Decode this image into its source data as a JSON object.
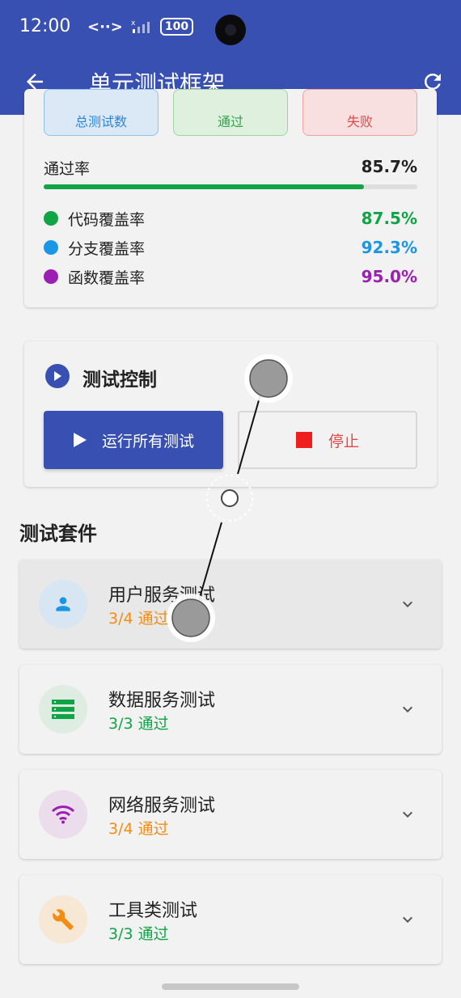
{
  "status_bar": {
    "time": "12:00",
    "net_icon": "<··>",
    "signal_icon": "signal-weak",
    "battery": "100"
  },
  "app_bar": {
    "title": "单元测试框架",
    "back_icon": "arrow-back-icon",
    "refresh_icon": "refresh-icon"
  },
  "summary": {
    "mini_boxes": [
      {
        "label": "总测试数",
        "color": "#2f86d6"
      },
      {
        "label": "通过",
        "color": "#2fa44a"
      },
      {
        "label": "失败",
        "color": "#de4b4b"
      }
    ],
    "pass_rate_label": "通过率",
    "pass_rate_value": "85.7%",
    "pass_rate_fraction": 0.857,
    "metrics": [
      {
        "label": "代码覆盖率",
        "value": "87.5%",
        "color": "#11a447"
      },
      {
        "label": "分支覆盖率",
        "value": "92.3%",
        "color": "#1b95e6"
      },
      {
        "label": "函数覆盖率",
        "value": "95.0%",
        "color": "#9b1fb2"
      }
    ]
  },
  "control": {
    "title": "测试控制",
    "run_label": "运行所有测试",
    "stop_label": "停止"
  },
  "suites_section": {
    "title": "测试套件",
    "items": [
      {
        "name": "用户服务测试",
        "status": "3/4 通过",
        "status_color": "#f28c12",
        "icon": "person-icon",
        "icon_color": "#1b95e6",
        "icon_bg": "#d7e6f2"
      },
      {
        "name": "数据服务测试",
        "status": "3/3 通过",
        "status_color": "#11a447",
        "icon": "storage-icon",
        "icon_color": "#11a447",
        "icon_bg": "#dfece1"
      },
      {
        "name": "网络服务测试",
        "status": "3/4 通过",
        "status_color": "#f28c12",
        "icon": "wifi-icon",
        "icon_color": "#9b1fb2",
        "icon_bg": "#ecdded"
      },
      {
        "name": "工具类测试",
        "status": "3/3 通过",
        "status_color": "#11a447",
        "icon": "wrench-icon",
        "icon_color": "#f28c12",
        "icon_bg": "#f7e8d6"
      }
    ]
  }
}
